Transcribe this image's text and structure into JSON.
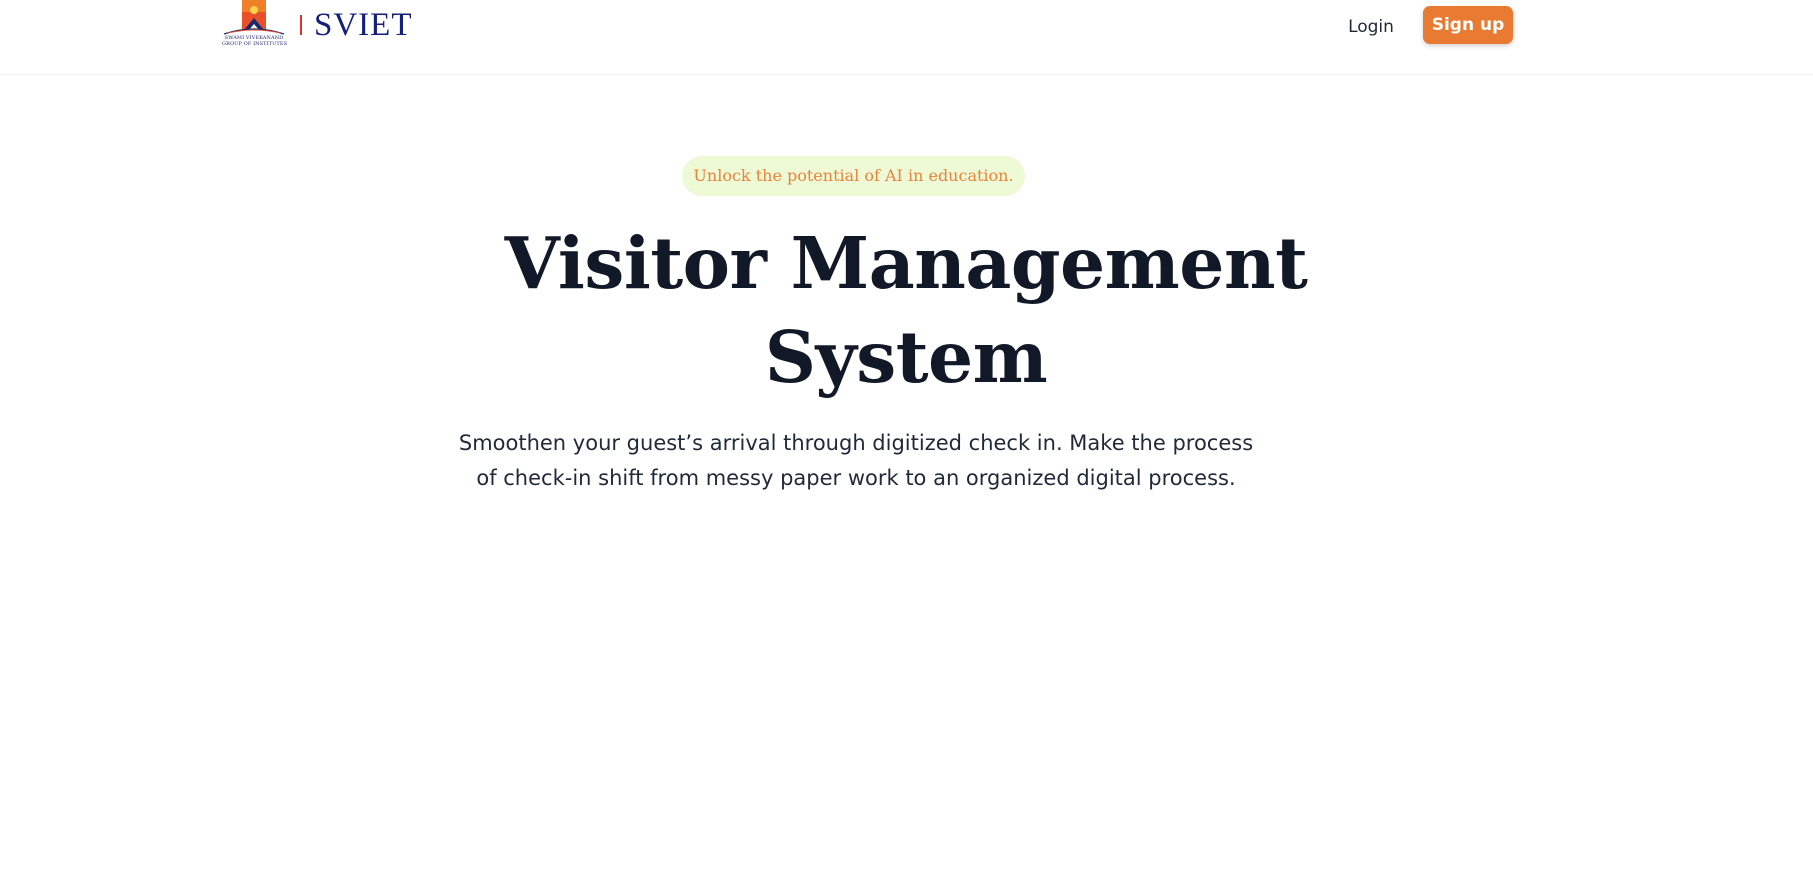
{
  "navbar": {
    "logo": {
      "caption_line1": "SWAMI VIVEKANAND",
      "caption_line2": "GROUP OF INSTITUTES",
      "brand": "SVIET"
    },
    "login_label": "Login",
    "signup_label": "Sign up"
  },
  "hero": {
    "badge": "Unlock the potential of AI in education.",
    "title_line1": "Visitor Management",
    "title_line2": "System",
    "subtitle": "Smoothen your guest’s arrival through digitized check in. Make the process of check-in shift from messy paper work to an organized digital process."
  },
  "colors": {
    "accent": "#e97a32",
    "badge_background": "#eef9d6",
    "brand_blue": "#14207a",
    "heading": "#111827"
  }
}
